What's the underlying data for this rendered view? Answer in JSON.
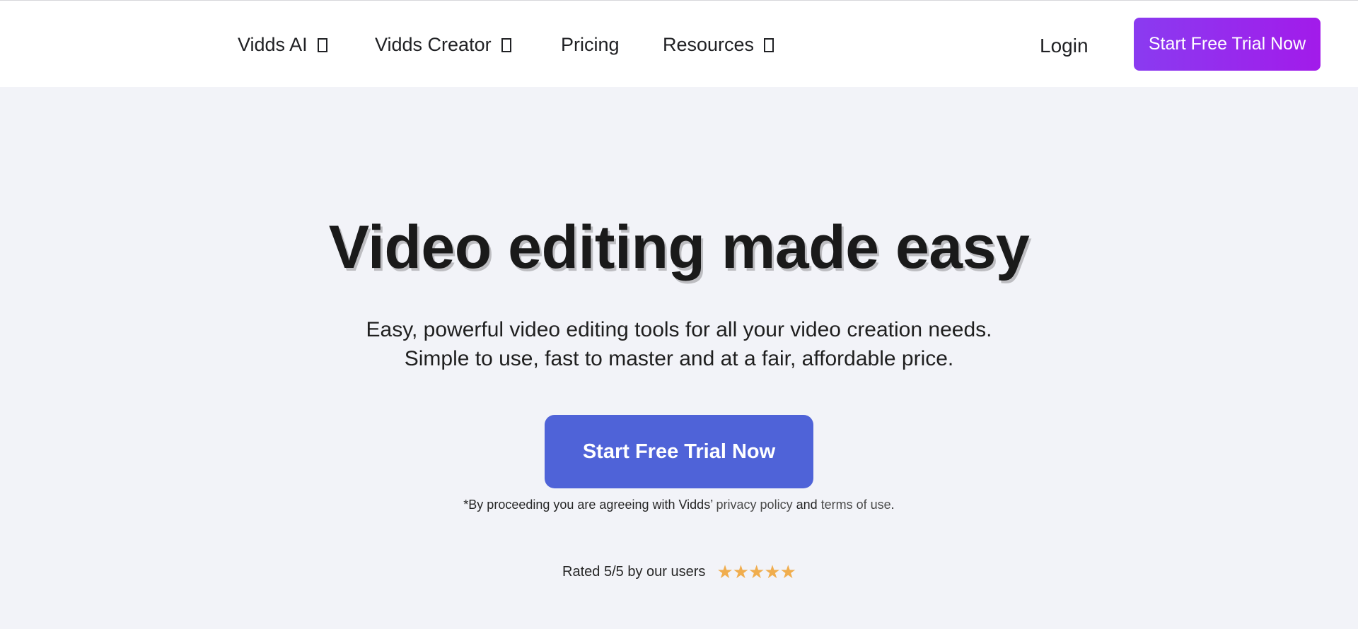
{
  "nav": {
    "items": [
      {
        "label": "Vidds AI",
        "has_dropdown": true
      },
      {
        "label": "Vidds Creator",
        "has_dropdown": true
      },
      {
        "label": "Pricing",
        "has_dropdown": false
      },
      {
        "label": "Resources",
        "has_dropdown": true
      }
    ],
    "login_label": "Login",
    "cta_label": "Start Free Trial Now"
  },
  "hero": {
    "title": "Video editing made easy",
    "subtitle_line1": "Easy, powerful video editing tools for all your video creation needs.",
    "subtitle_line2": "Simple to use, fast to master and at a fair, affordable price.",
    "cta_label": "Start Free Trial Now",
    "disclaimer": {
      "prefix": "*By proceeding you are agreeing with Vidds’ ",
      "privacy_link": "privacy policy",
      "middle": " and ",
      "terms_link": "terms of use",
      "suffix": "."
    },
    "rating": {
      "text": "Rated 5/5 by our users",
      "stars": "★★★★★",
      "value": 5,
      "max": 5
    }
  },
  "colors": {
    "page_bg": "#f2f3f8",
    "header_bg": "#ffffff",
    "header_cta_gradient_start": "#8a3bf0",
    "header_cta_gradient_end": "#a21bea",
    "hero_cta_bg": "#4f63d8",
    "star_color": "#f0ad4e"
  }
}
